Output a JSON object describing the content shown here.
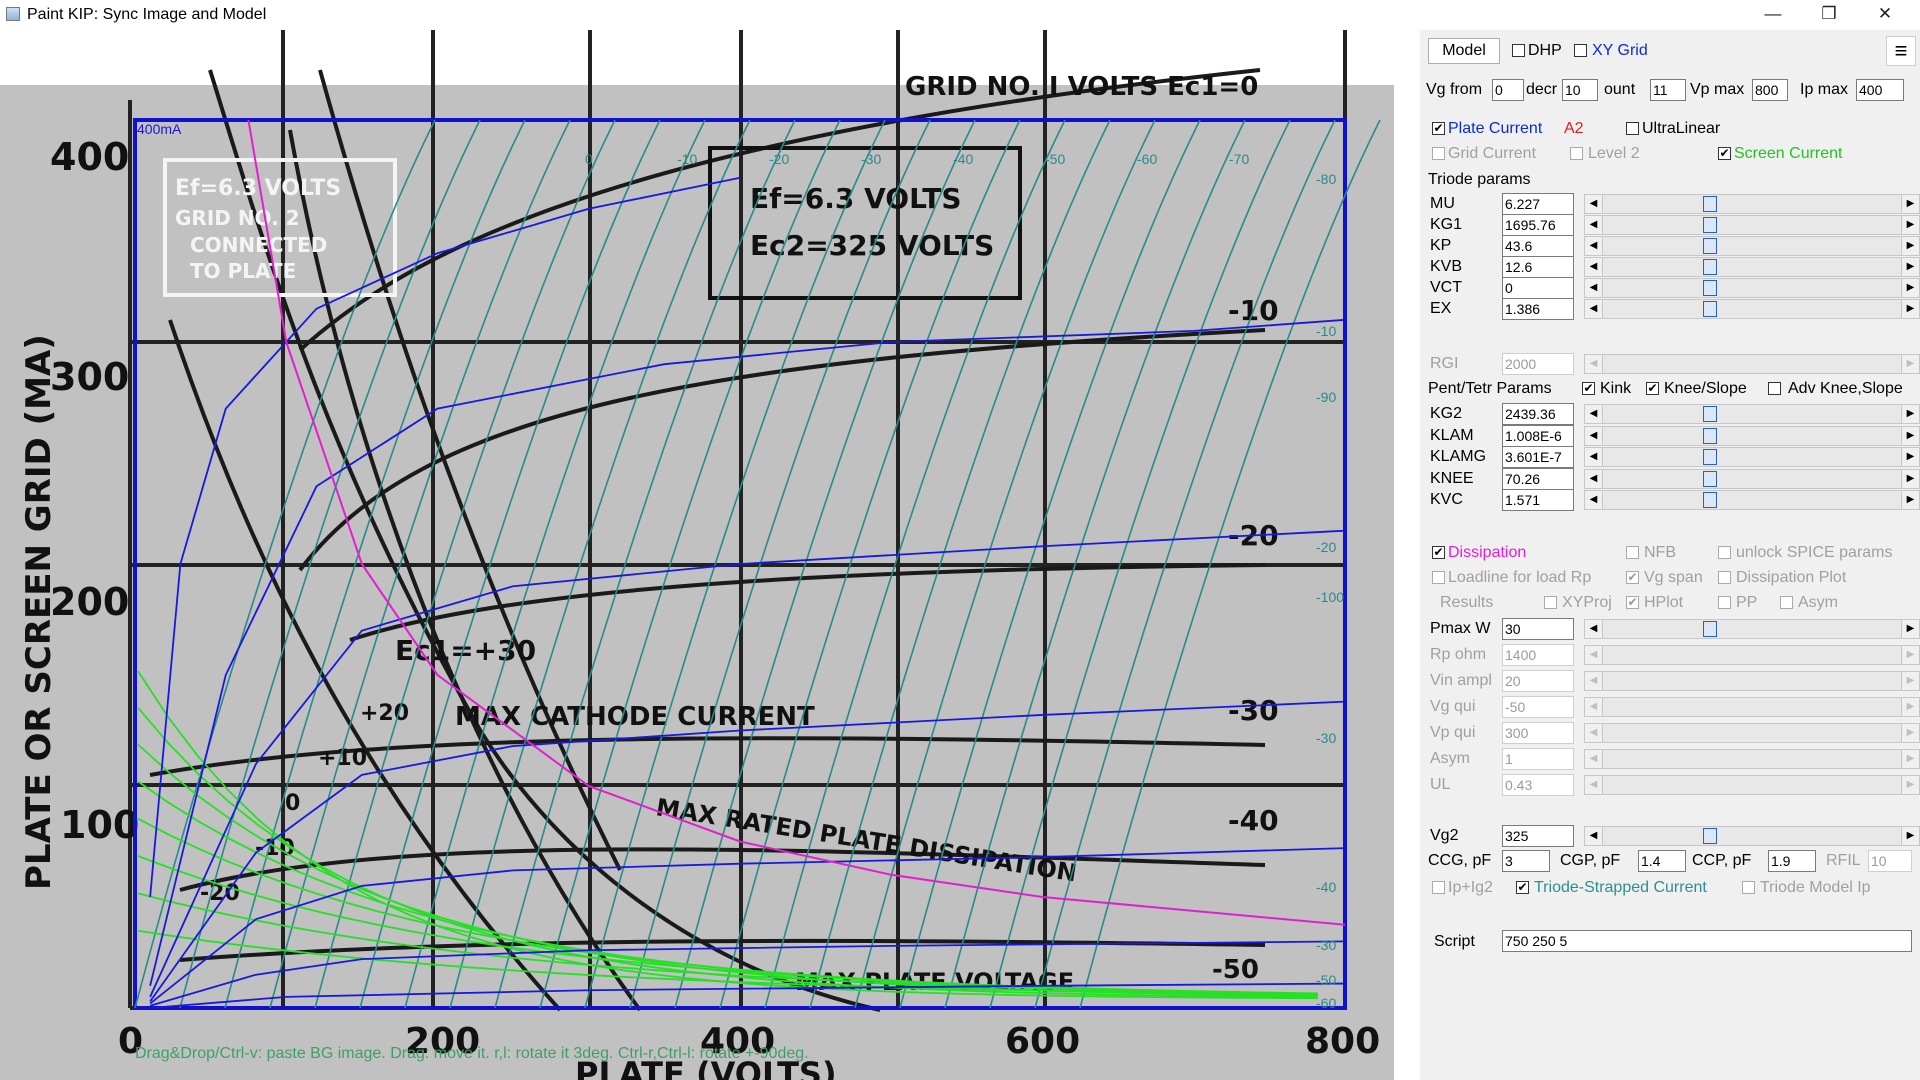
{
  "window": {
    "title": "Paint KIP: Sync Image and Model",
    "minimize": "—",
    "maximize": "❒",
    "close": "✕"
  },
  "plot": {
    "hint": "Drag&Drop/Ctrl-v: paste BG image. Drag: move it. r,l: rotate it  3deg. Ctrl-r,Ctrl-l: rotate +-90deg.",
    "scan": {
      "ylabel": "PLATE OR SCREEN GRID (MA)",
      "xlabel": "PLATE (VOLTS)",
      "header": "GRID NO. I VOLTS Ec1=0",
      "box1": "Ef=6.3 VOLTS",
      "box2": "Ec2=325 VOLTS",
      "boxleft1": "Ef=6.3 VOLTS",
      "boxleft2": "GRID NO. 2",
      "boxleft3": "CONNECTED",
      "boxleft4": "TO PLATE",
      "ec1": "Ec1=+30",
      "maxcathode": "MAX CATHODE CURRENT",
      "maxplatediss": "MAX RATED PLATE DISSIPATION",
      "maxplatevolt": "MAX PLATE VOLTAGE",
      "yticks": [
        "400",
        "300",
        "200",
        "100"
      ],
      "xticks": [
        "0",
        "200",
        "400",
        "600",
        "800"
      ],
      "curve_labels": [
        "-10",
        "-20",
        "-30",
        "-40",
        "-50"
      ],
      "small_labels": [
        "+20",
        "+10",
        "0",
        "-10",
        "-20"
      ]
    },
    "overlay": {
      "corner": "400mA",
      "top_labels": [
        "0",
        "-10",
        "-20",
        "-30",
        "-40",
        "-50",
        "-60",
        "-70"
      ],
      "right_labels": [
        "-80",
        "-10",
        "-90",
        "-20",
        "-100",
        "-30",
        "-40",
        "-30",
        "-50",
        "-60"
      ]
    },
    "chart_data": {
      "type": "line",
      "xlim": [
        0,
        800
      ],
      "ylim": [
        0,
        400
      ],
      "x_unit": "V",
      "y_unit": "mA",
      "overlay_series": [
        {
          "name": "Vg 0",
          "points": [
            [
              10,
              50
            ],
            [
              30,
              200
            ],
            [
              60,
              270
            ],
            [
              120,
              315
            ],
            [
              200,
              340
            ],
            [
              300,
              360
            ],
            [
              400,
              374
            ]
          ]
        },
        {
          "name": "-10",
          "points": [
            [
              10,
              10
            ],
            [
              60,
              150
            ],
            [
              120,
              235
            ],
            [
              200,
              270
            ],
            [
              350,
              290
            ],
            [
              500,
              300
            ],
            [
              700,
              305
            ],
            [
              800,
              310
            ]
          ]
        },
        {
          "name": "-20",
          "points": [
            [
              10,
              5
            ],
            [
              80,
              110
            ],
            [
              150,
              170
            ],
            [
              250,
              190
            ],
            [
              400,
              200
            ],
            [
              600,
              208
            ],
            [
              800,
              215
            ]
          ]
        },
        {
          "name": "-30",
          "points": [
            [
              10,
              3
            ],
            [
              80,
              70
            ],
            [
              150,
              105
            ],
            [
              250,
              118
            ],
            [
              400,
              125
            ],
            [
              600,
              132
            ],
            [
              800,
              138
            ]
          ]
        },
        {
          "name": "-40",
          "points": [
            [
              10,
              2
            ],
            [
              80,
              40
            ],
            [
              150,
              55
            ],
            [
              250,
              62
            ],
            [
              400,
              65
            ],
            [
              600,
              68
            ],
            [
              800,
              72
            ]
          ]
        },
        {
          "name": "-50",
          "points": [
            [
              10,
              1
            ],
            [
              80,
              15
            ],
            [
              150,
              22
            ],
            [
              300,
              26
            ],
            [
              500,
              28
            ],
            [
              800,
              30
            ]
          ]
        },
        {
          "name": "-60",
          "points": [
            [
              10,
              0
            ],
            [
              100,
              5
            ],
            [
              300,
              8
            ],
            [
              600,
              10
            ],
            [
              800,
              11
            ]
          ]
        }
      ],
      "dissipation": {
        "name": "Pmax 30 W",
        "points": [
          [
            75,
            400
          ],
          [
            100,
            300
          ],
          [
            150,
            200
          ],
          [
            200,
            150
          ],
          [
            300,
            100
          ],
          [
            400,
            75
          ],
          [
            500,
            60
          ],
          [
            600,
            50
          ],
          [
            800,
            37.5
          ]
        ]
      }
    }
  },
  "panel": {
    "tab_model": "Model",
    "dhp": "DHP",
    "xygrid": "XY Grid",
    "menu_icon": "≡",
    "vg_from_label": "Vg from",
    "vg_from": "0",
    "decr_label": "decr",
    "decr": "10",
    "count_label": "ount",
    "count": "11",
    "vpmax_label": "Vp max",
    "vpmax": "800",
    "ipmax_label": "Ip max",
    "ipmax": "400",
    "plate_current": "Plate Current",
    "a2": "A2",
    "ultralinear": "UltraLinear",
    "grid_current": "Grid Current",
    "level2": "Level 2",
    "screen_current": "Screen Current",
    "triode_params": "Triode params",
    "params": [
      {
        "label": "MU",
        "value": "6.227"
      },
      {
        "label": "KG1",
        "value": "1695.76"
      },
      {
        "label": "KP",
        "value": "43.6"
      },
      {
        "label": "KVB",
        "value": "12.6"
      },
      {
        "label": "VCT",
        "value": "0"
      },
      {
        "label": "EX",
        "value": "1.386"
      }
    ],
    "rgi_label": "RGI",
    "rgi": "2000",
    "pent_params": "Pent/Tetr Params",
    "kink": "Kink",
    "knee_slope": "Knee/Slope",
    "adv_knee": "Adv Knee,Slope",
    "pent": [
      {
        "label": "KG2",
        "value": "2439.36"
      },
      {
        "label": "KLAM",
        "value": "1.008E-6"
      },
      {
        "label": "KLAMG",
        "value": "3.601E-7"
      },
      {
        "label": "KNEE",
        "value": "70.26"
      },
      {
        "label": "KVC",
        "value": "1.571"
      }
    ],
    "dissipation": "Dissipation",
    "nfb": "NFB",
    "unlock_spice": "unlock SPICE params",
    "loadline": "Loadline for load Rp",
    "vg_span": "Vg span",
    "dissipation_plot": "Dissipation Plot",
    "results": "Results",
    "xyproj": "XYProj",
    "hplot": "HPlot",
    "pp": "PP",
    "asym_cb": "Asym",
    "pmax_label": "Pmax W",
    "pmax": "30",
    "dim_params": [
      {
        "label": "Rp ohm",
        "value": "1400"
      },
      {
        "label": "Vin ampl",
        "value": "20"
      },
      {
        "label": "Vg qui",
        "value": "-50"
      },
      {
        "label": "Vp qui",
        "value": "300"
      },
      {
        "label": "Asym",
        "value": "1"
      },
      {
        "label": "UL",
        "value": "0.43"
      }
    ],
    "vg2_label": "Vg2",
    "vg2": "325",
    "ccg_label": "CCG, pF",
    "ccg": "3",
    "cgp_label": "CGP, pF",
    "cgp": "1.4",
    "ccp_label": "CCP, pF",
    "ccp": "1.9",
    "rfil_label": "RFIL",
    "rfil": "10",
    "ipig2": "Ip+Ig2",
    "triode_strapped": "Triode-Strapped Current",
    "triode_model_ip": "Triode Model Ip",
    "script_label": "Script",
    "script": "750 250 5"
  }
}
